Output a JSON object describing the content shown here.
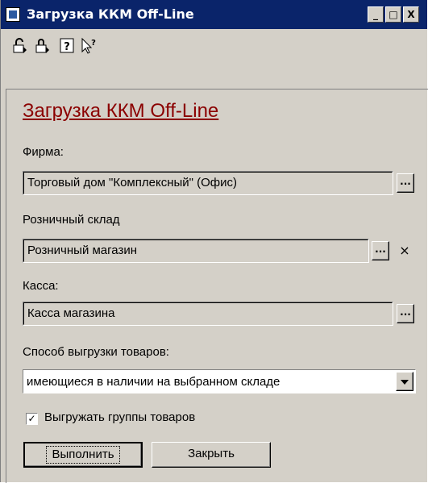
{
  "window": {
    "title": "Загрузка ККМ Off-Line",
    "minimize": "_",
    "maximize": "□",
    "close": "X"
  },
  "toolbar": {
    "icons": [
      "unlock-icon",
      "lock-icon",
      "help-icon",
      "context-help-icon"
    ],
    "help_glyph": "?"
  },
  "form": {
    "title": "Загрузка ККМ Off-Line",
    "firm": {
      "label": "Фирма:",
      "value": "Торговый дом \"Комплексный\" (Офис)",
      "button": "..."
    },
    "warehouse": {
      "label": "Розничный склад",
      "value": "Розничный магазин",
      "button": "...",
      "clear": "×"
    },
    "cash": {
      "label": "Касса:",
      "value": "Касса магазина",
      "button": "..."
    },
    "export_mode": {
      "label": "Способ выгрузки товаров:",
      "value": "имеющиеся в наличии на выбранном складе"
    },
    "export_groups": {
      "checked": true,
      "check_mark": "✓",
      "label": "Выгружать группы товаров"
    },
    "buttons": {
      "execute": "Выполнить",
      "close": "Закрыть"
    }
  }
}
